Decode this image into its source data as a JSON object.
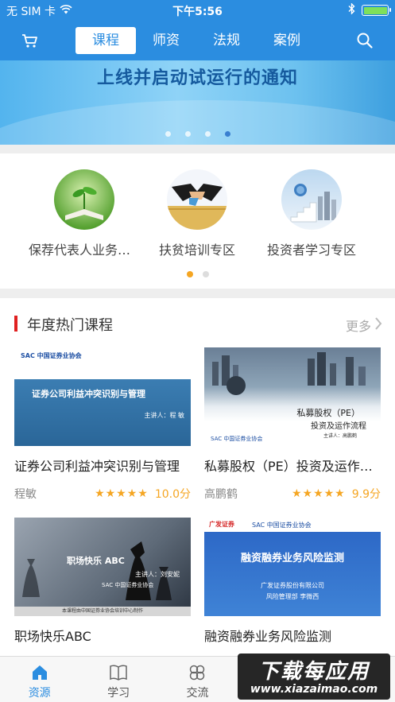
{
  "status_bar": {
    "carrier": "无 SIM 卡",
    "time": "下午5:56"
  },
  "nav": {
    "tabs": [
      {
        "label": "课程",
        "active": true
      },
      {
        "label": "师资",
        "active": false
      },
      {
        "label": "法规",
        "active": false
      },
      {
        "label": "案例",
        "active": false
      }
    ],
    "cart_icon": "cart-icon",
    "search_icon": "search-icon"
  },
  "banner": {
    "title": "上线并启动试运行的通知",
    "dots": 4,
    "active_dot": 4
  },
  "categories": {
    "items": [
      {
        "label": "保荐代表人业务培训专区",
        "icon": "book-sprout-icon"
      },
      {
        "label": "扶贫培训专区",
        "icon": "handshake-icon"
      },
      {
        "label": "投资者学习专区",
        "icon": "stairs-city-icon"
      }
    ],
    "pages": 2,
    "active_page": 1
  },
  "section": {
    "title": "年度热门课程",
    "more_label": "更多",
    "courses": [
      {
        "title": "证券公司利益冲突识别与管理",
        "teacher": "程敏",
        "score": "10.0分",
        "rating": 5,
        "thumb": {
          "logo": "SAC 中国证券业协会",
          "text": "证券公司利益冲突识别与管理",
          "speaker": "主讲人：程 敏"
        }
      },
      {
        "title": "私募股权（PE）投资及运作流程",
        "teacher": "高鹏鹤",
        "score": "9.9分",
        "rating": 5,
        "thumb": {
          "logo": "SAC 中国证券业协会",
          "text1": "私募股权（PE）",
          "text2": "投资及运作流程",
          "speaker": "主讲人：高鹏鹤"
        }
      },
      {
        "title": "职场快乐ABC",
        "thumb": {
          "logo": "SAC 中国证券业协会",
          "text": "职场快乐 ABC",
          "speaker": "主讲人：刘安妮",
          "footer": "本课程由中国证券业协会培训中心制作"
        }
      },
      {
        "title": "融资融券业务风险监测",
        "thumb": {
          "logo1": "广发证券",
          "logo2": "SAC 中国证券业协会",
          "text": "融资融券业务风险监测",
          "line1": "广发证券股份有限公司",
          "line2": "风险管理部  李微西"
        }
      }
    ]
  },
  "tabbar": {
    "items": [
      {
        "label": "资源",
        "icon": "home-icon",
        "active": true
      },
      {
        "label": "学习",
        "icon": "book-icon",
        "active": false
      },
      {
        "label": "交流",
        "icon": "clover-icon",
        "active": false
      }
    ]
  },
  "watermark": {
    "top": "下载每应用",
    "bottom": "www.xiazaimao.com"
  },
  "colors": {
    "primary": "#2b8de0",
    "accent": "#f5a623",
    "section_bar": "#e02020"
  }
}
